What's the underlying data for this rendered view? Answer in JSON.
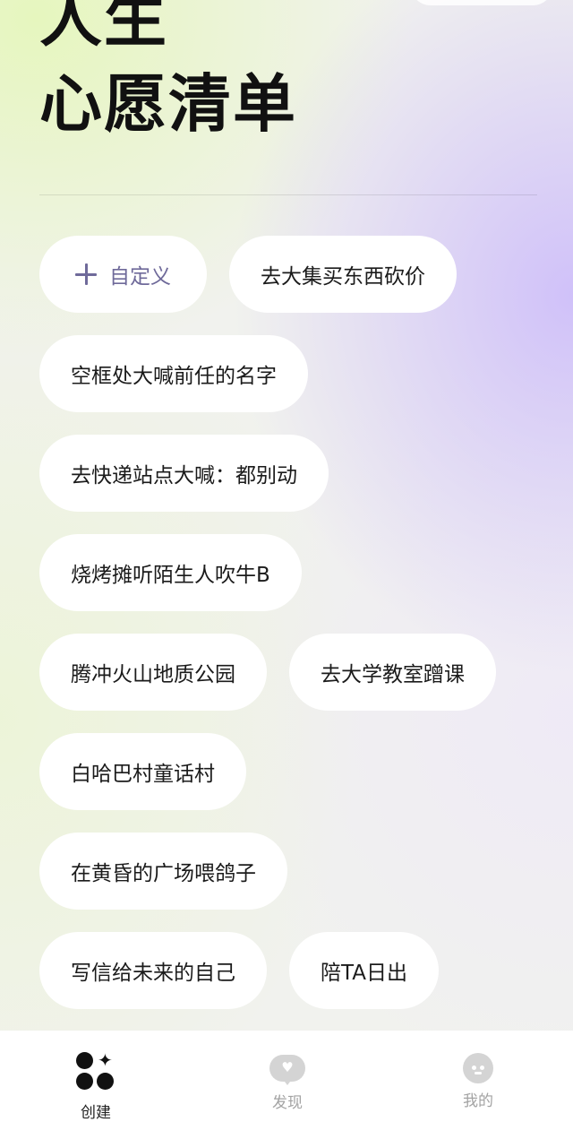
{
  "header": {
    "title_line1": "人生",
    "title_line2": "心愿清单"
  },
  "custom_button": {
    "icon": "plus-icon",
    "label": "自定义"
  },
  "wishes": [
    "去大集买东西砍价",
    "空框处大喊前任的名字",
    "去快递站点大喊：都别动",
    "烧烤摊听陌生人吹牛B",
    "腾冲火山地质公园",
    "去大学教室蹭课",
    "白哈巴村童话村",
    "在黄昏的广场喂鸽子",
    "写信给未来的自己",
    "陪TA日出"
  ],
  "tabs": [
    {
      "label": "创建",
      "icon": "create-icon",
      "active": true
    },
    {
      "label": "发现",
      "icon": "chat-heart-icon",
      "active": false
    },
    {
      "label": "我的",
      "icon": "smiley-icon",
      "active": false
    }
  ],
  "colors": {
    "accent": "#6f6a9a",
    "active_tab": "#222222",
    "inactive_tab": "#a3a3a3"
  }
}
